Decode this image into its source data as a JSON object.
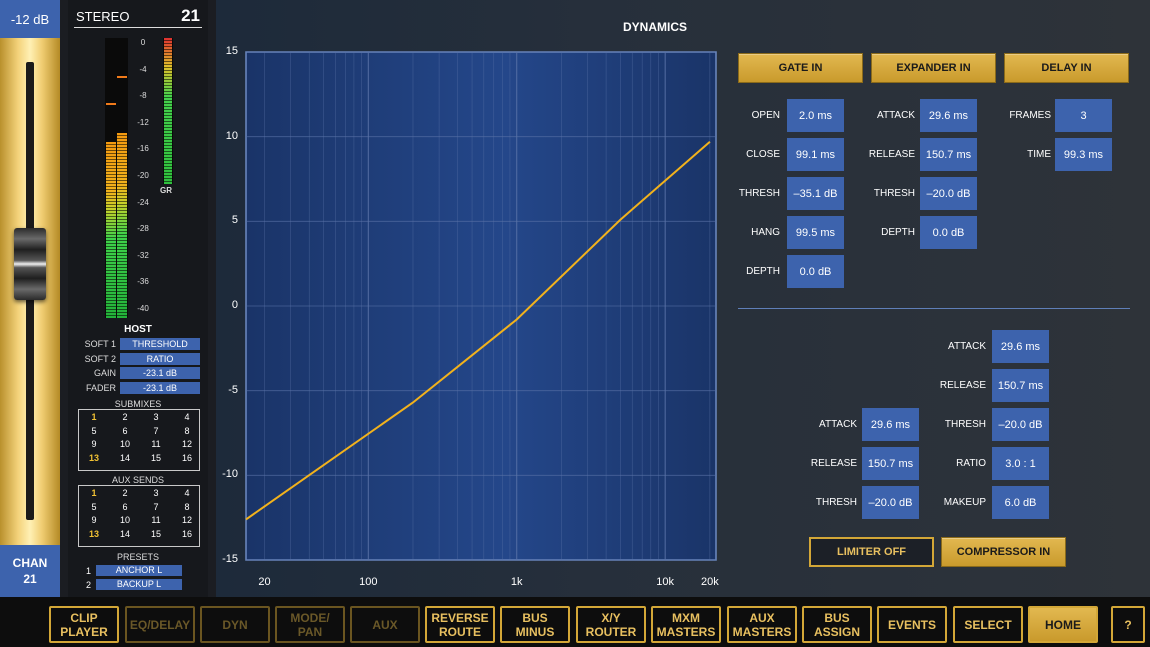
{
  "fader": {
    "db": "-12 dB",
    "chan_label": "CHAN",
    "chan_num": "21"
  },
  "channel": {
    "name": "STEREO",
    "number": "21",
    "scale": [
      "0",
      "-4",
      "-8",
      "-12",
      "-16",
      "-20",
      "-24",
      "-28",
      "-32",
      "-36",
      "-40"
    ],
    "gr_label": "GR",
    "meter_left_level": 0.63,
    "meter_right_level": 0.66,
    "gr_level": 1.0
  },
  "host": {
    "title": "HOST",
    "rows": [
      {
        "label": "SOFT 1",
        "value": "THRESHOLD"
      },
      {
        "label": "SOFT 2",
        "value": "RATIO"
      },
      {
        "label": "GAIN",
        "value": "-23.1 dB"
      },
      {
        "label": "FADER",
        "value": "-23.1 dB"
      }
    ]
  },
  "submixes": {
    "title": "SUBMIXES",
    "cells": [
      "1",
      "2",
      "3",
      "4",
      "5",
      "6",
      "7",
      "8",
      "9",
      "10",
      "11",
      "12",
      "13",
      "14",
      "15",
      "16"
    ],
    "highlight": [
      "1",
      "13"
    ]
  },
  "aux_sends": {
    "title": "AUX SENDS",
    "cells": [
      "1",
      "2",
      "3",
      "4",
      "5",
      "6",
      "7",
      "8",
      "9",
      "10",
      "11",
      "12",
      "13",
      "14",
      "15",
      "16"
    ],
    "highlight": [
      "1",
      "13"
    ]
  },
  "presets": {
    "title": "PRESETS",
    "items": [
      {
        "n": "1",
        "name": "ANCHOR L"
      },
      {
        "n": "2",
        "name": "BACKUP L"
      }
    ]
  },
  "dynamics": {
    "title": "DYNAMICS",
    "buttons": {
      "gate": "GATE IN",
      "expander": "EXPANDER IN",
      "delay": "DELAY IN",
      "limiter": "LIMITER OFF",
      "compressor": "COMPRESSOR IN"
    },
    "gate": [
      {
        "label": "OPEN",
        "value": "2.0 ms"
      },
      {
        "label": "CLOSE",
        "value": "99.1 ms"
      },
      {
        "label": "THRESH",
        "value": "–35.1 dB"
      },
      {
        "label": "HANG",
        "value": "99.5 ms"
      },
      {
        "label": "DEPTH",
        "value": "0.0 dB"
      }
    ],
    "expander": [
      {
        "label": "ATTACK",
        "value": "29.6 ms"
      },
      {
        "label": "RELEASE",
        "value": "150.7 ms"
      },
      {
        "label": "THRESH",
        "value": "–20.0 dB"
      },
      {
        "label": "DEPTH",
        "value": "0.0 dB"
      }
    ],
    "delay": [
      {
        "label": "FRAMES",
        "value": "3"
      },
      {
        "label": "TIME",
        "value": "99.3 ms"
      }
    ],
    "limiter": [
      {
        "label": "ATTACK",
        "value": "29.6 ms"
      },
      {
        "label": "RELEASE",
        "value": "150.7 ms"
      },
      {
        "label": "THRESH",
        "value": "–20.0 dB"
      }
    ],
    "compressor": [
      {
        "label": "ATTACK",
        "value": "29.6 ms"
      },
      {
        "label": "RELEASE",
        "value": "150.7 ms"
      },
      {
        "label": "THRESH",
        "value": "–20.0 dB"
      },
      {
        "label": "RATIO",
        "value": "3.0 : 1"
      },
      {
        "label": "MAKEUP",
        "value": "6.0 dB"
      }
    ]
  },
  "chart_data": {
    "type": "line",
    "x_scale": "log",
    "xlim": [
      15,
      22000
    ],
    "ylim": [
      -15,
      15
    ],
    "y_ticks": [
      "15",
      "10",
      "5",
      "0",
      "-5",
      "-10",
      "-15"
    ],
    "x_ticks": [
      "20",
      "100",
      "1k",
      "10k",
      "20k"
    ],
    "x_tick_values": [
      20,
      100,
      1000,
      10000,
      20000
    ],
    "y_tick_values": [
      15,
      10,
      5,
      0,
      -5,
      -10,
      -15
    ],
    "series": [
      {
        "x": [
          15,
          200,
          1000,
          5000,
          20000
        ],
        "y": [
          -12.6,
          -5.7,
          -0.8,
          5.1,
          9.7
        ]
      }
    ],
    "grid": true,
    "colors": {
      "curve": "#f2b21c",
      "plot_bg": "#1f3f7a",
      "grid": "#5a73a8"
    }
  },
  "nav": [
    {
      "label": "CLIP\nPLAYER",
      "state": "normal"
    },
    {
      "label": "EQ/DELAY",
      "state": "dim"
    },
    {
      "label": "DYN",
      "state": "dim"
    },
    {
      "label": "MODE/\nPAN",
      "state": "dim"
    },
    {
      "label": "AUX",
      "state": "dim"
    },
    {
      "label": "REVERSE\nROUTE",
      "state": "normal"
    },
    {
      "label": "BUS\nMINUS",
      "state": "normal"
    },
    {
      "label": "X/Y\nROUTER",
      "state": "normal"
    },
    {
      "label": "MXM\nMASTERS",
      "state": "normal"
    },
    {
      "label": "AUX\nMASTERS",
      "state": "normal"
    },
    {
      "label": "BUS\nASSIGN",
      "state": "normal"
    },
    {
      "label": "EVENTS",
      "state": "normal"
    },
    {
      "label": "SELECT",
      "state": "normal"
    },
    {
      "label": "HOME",
      "state": "active"
    },
    {
      "label": "?",
      "state": "normal"
    }
  ]
}
